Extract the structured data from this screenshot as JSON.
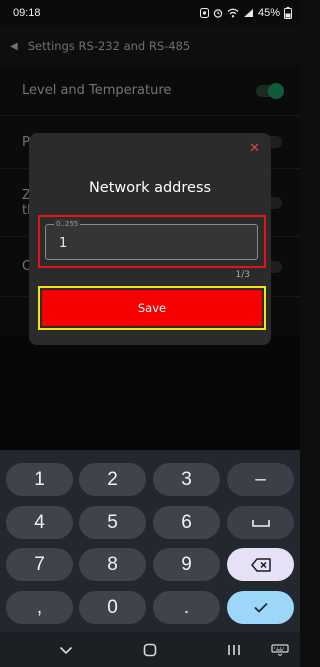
{
  "status": {
    "time": "09:18",
    "battery": "45%"
  },
  "header": {
    "title": "Settings RS-232 and RS-485"
  },
  "background_rows": [
    {
      "label": "Level and Temperature"
    },
    {
      "label": "P"
    },
    {
      "label": "Z"
    },
    {
      "label": "th"
    },
    {
      "label": "C"
    }
  ],
  "dialog": {
    "title": "Network address",
    "input_legend": "0..255",
    "input_value": "1",
    "counter": "1/3",
    "save_label": "Save"
  },
  "keyboard": {
    "rows": [
      [
        "1",
        "2",
        "3",
        "–"
      ],
      [
        "4",
        "5",
        "6",
        "␣"
      ],
      [
        "7",
        "8",
        "9",
        "⌫"
      ],
      [
        ",",
        "0",
        ".",
        "✓"
      ]
    ]
  },
  "colors": {
    "accent_green": "#1ea86a",
    "save_red": "#f70000",
    "highlight_yellow": "#f2e418",
    "highlight_red": "#e3141e"
  }
}
